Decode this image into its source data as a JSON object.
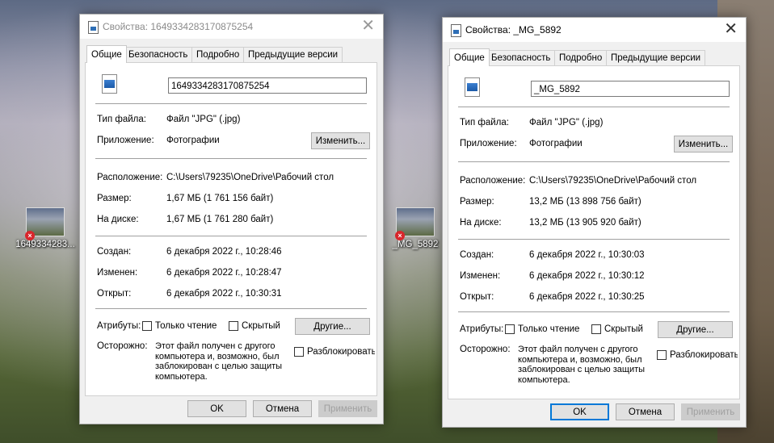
{
  "desktop": {
    "icons": [
      {
        "label": "1649334283..."
      },
      {
        "label": "_MG_5892"
      }
    ]
  },
  "windows": [
    {
      "title": "Свойства: 1649334283170875254",
      "tabs": [
        "Общие",
        "Безопасность",
        "Подробно",
        "Предыдущие версии"
      ],
      "filename": "1649334283170875254",
      "labels": {
        "type": "Тип файла:",
        "app": "Приложение:",
        "location": "Расположение:",
        "size": "Размер:",
        "disk": "На диске:",
        "created": "Создан:",
        "modified": "Изменен:",
        "opened": "Открыт:",
        "attributes": "Атрибуты:",
        "caution": "Осторожно:"
      },
      "values": {
        "type": "Файл \"JPG\" (.jpg)",
        "app": "Фотографии",
        "location": "C:\\Users\\79235\\OneDrive\\Рабочий стол",
        "size": "1,67 МБ (1 761 156 байт)",
        "disk": "1,67 МБ (1 761 280 байт)",
        "created": "6 декабря 2022 г., 10:28:46",
        "modified": "6 декабря 2022 г., 10:28:47",
        "opened": "6 декабря 2022 г., 10:30:31"
      },
      "buttons": {
        "change": "Изменить...",
        "other": "Другие...",
        "ok": "OK",
        "cancel": "Отмена",
        "apply": "Применить"
      },
      "checkboxes": {
        "readonly": "Только чтение",
        "hidden": "Скрытый",
        "unblock": "Разблокировать"
      },
      "caution_text": "Этот файл получен с другого компьютера и, возможно, был заблокирован с целью защиты компьютера."
    },
    {
      "title": "Свойства: _MG_5892",
      "tabs": [
        "Общие",
        "Безопасность",
        "Подробно",
        "Предыдущие версии"
      ],
      "filename": "_MG_5892",
      "labels": {
        "type": "Тип файла:",
        "app": "Приложение:",
        "location": "Расположение:",
        "size": "Размер:",
        "disk": "На диске:",
        "created": "Создан:",
        "modified": "Изменен:",
        "opened": "Открыт:",
        "attributes": "Атрибуты:",
        "caution": "Осторожно:"
      },
      "values": {
        "type": "Файл \"JPG\" (.jpg)",
        "app": "Фотографии",
        "location": "C:\\Users\\79235\\OneDrive\\Рабочий стол",
        "size": "13,2 МБ (13 898 756 байт)",
        "disk": "13,2 МБ (13 905 920 байт)",
        "created": "6 декабря 2022 г., 10:30:03",
        "modified": "6 декабря 2022 г., 10:30:12",
        "opened": "6 декабря 2022 г., 10:30:25"
      },
      "buttons": {
        "change": "Изменить...",
        "other": "Другие...",
        "ok": "OK",
        "cancel": "Отмена",
        "apply": "Применить"
      },
      "checkboxes": {
        "readonly": "Только чтение",
        "hidden": "Скрытый",
        "unblock": "Разблокировать"
      },
      "caution_text": "Этот файл получен с другого компьютера и, возможно, был заблокирован с целью защиты компьютера."
    }
  ]
}
